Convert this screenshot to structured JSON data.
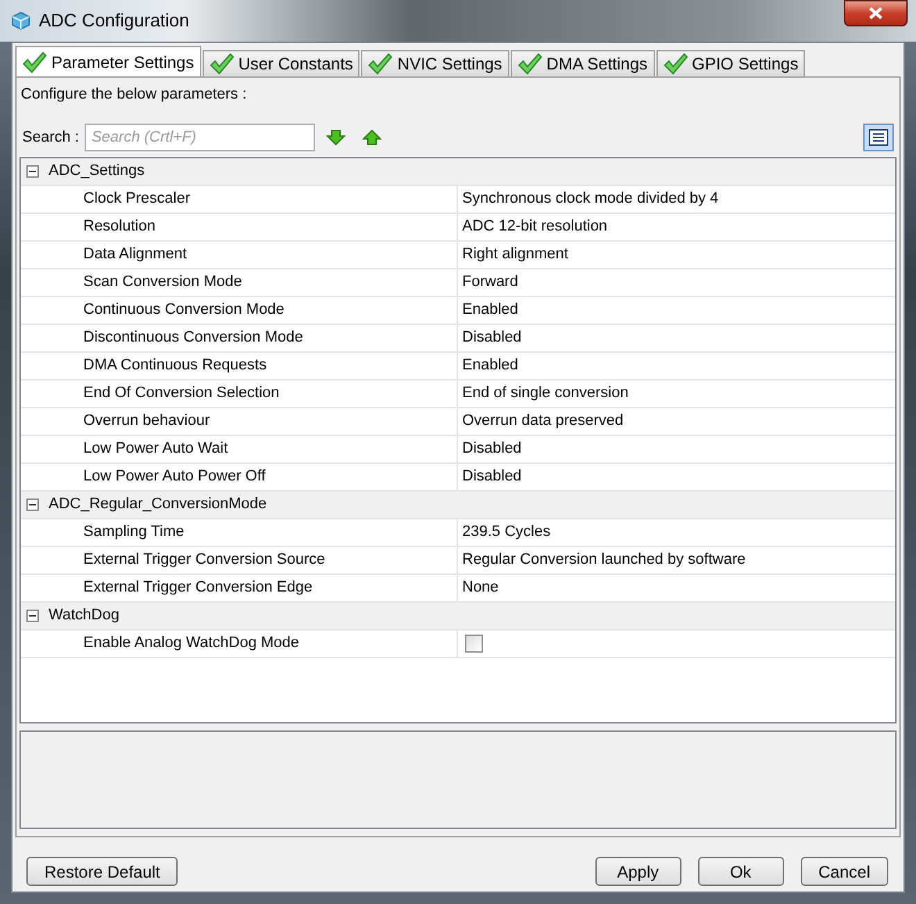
{
  "window": {
    "title": "ADC Configuration"
  },
  "tabs": [
    {
      "label": "Parameter Settings",
      "selected": true
    },
    {
      "label": "User Constants",
      "selected": false
    },
    {
      "label": "NVIC Settings",
      "selected": false
    },
    {
      "label": "DMA Settings",
      "selected": false
    },
    {
      "label": "GPIO Settings",
      "selected": false
    }
  ],
  "intro": "Configure the below parameters :",
  "search": {
    "label": "Search :",
    "placeholder": "Search (Crtl+F)"
  },
  "groups": [
    {
      "name": "ADC_Settings",
      "expanded": true,
      "rows": [
        {
          "name": "Clock Prescaler",
          "value": "Synchronous clock mode divided by 4"
        },
        {
          "name": "Resolution",
          "value": "ADC 12-bit resolution"
        },
        {
          "name": "Data Alignment",
          "value": "Right alignment"
        },
        {
          "name": "Scan Conversion Mode",
          "value": "Forward"
        },
        {
          "name": "Continuous Conversion Mode",
          "value": "Enabled"
        },
        {
          "name": "Discontinuous Conversion Mode",
          "value": "Disabled"
        },
        {
          "name": "DMA Continuous Requests",
          "value": "Enabled"
        },
        {
          "name": "End Of Conversion Selection",
          "value": "End of single conversion"
        },
        {
          "name": "Overrun behaviour",
          "value": "Overrun data preserved"
        },
        {
          "name": "Low Power Auto Wait",
          "value": "Disabled"
        },
        {
          "name": "Low Power Auto Power Off",
          "value": "Disabled"
        }
      ]
    },
    {
      "name": "ADC_Regular_ConversionMode",
      "expanded": true,
      "rows": [
        {
          "name": "Sampling Time",
          "value": "239.5 Cycles"
        },
        {
          "name": "External Trigger Conversion Source",
          "value": "Regular Conversion launched by software"
        },
        {
          "name": "External Trigger Conversion Edge",
          "value": "None"
        }
      ]
    },
    {
      "name": "WatchDog",
      "expanded": true,
      "rows": [
        {
          "name": "Enable Analog WatchDog Mode",
          "kind": "checkbox",
          "checked": false
        }
      ]
    }
  ],
  "buttons": {
    "left": [
      "Restore Default"
    ],
    "right": [
      "Apply",
      "Ok",
      "Cancel"
    ]
  }
}
